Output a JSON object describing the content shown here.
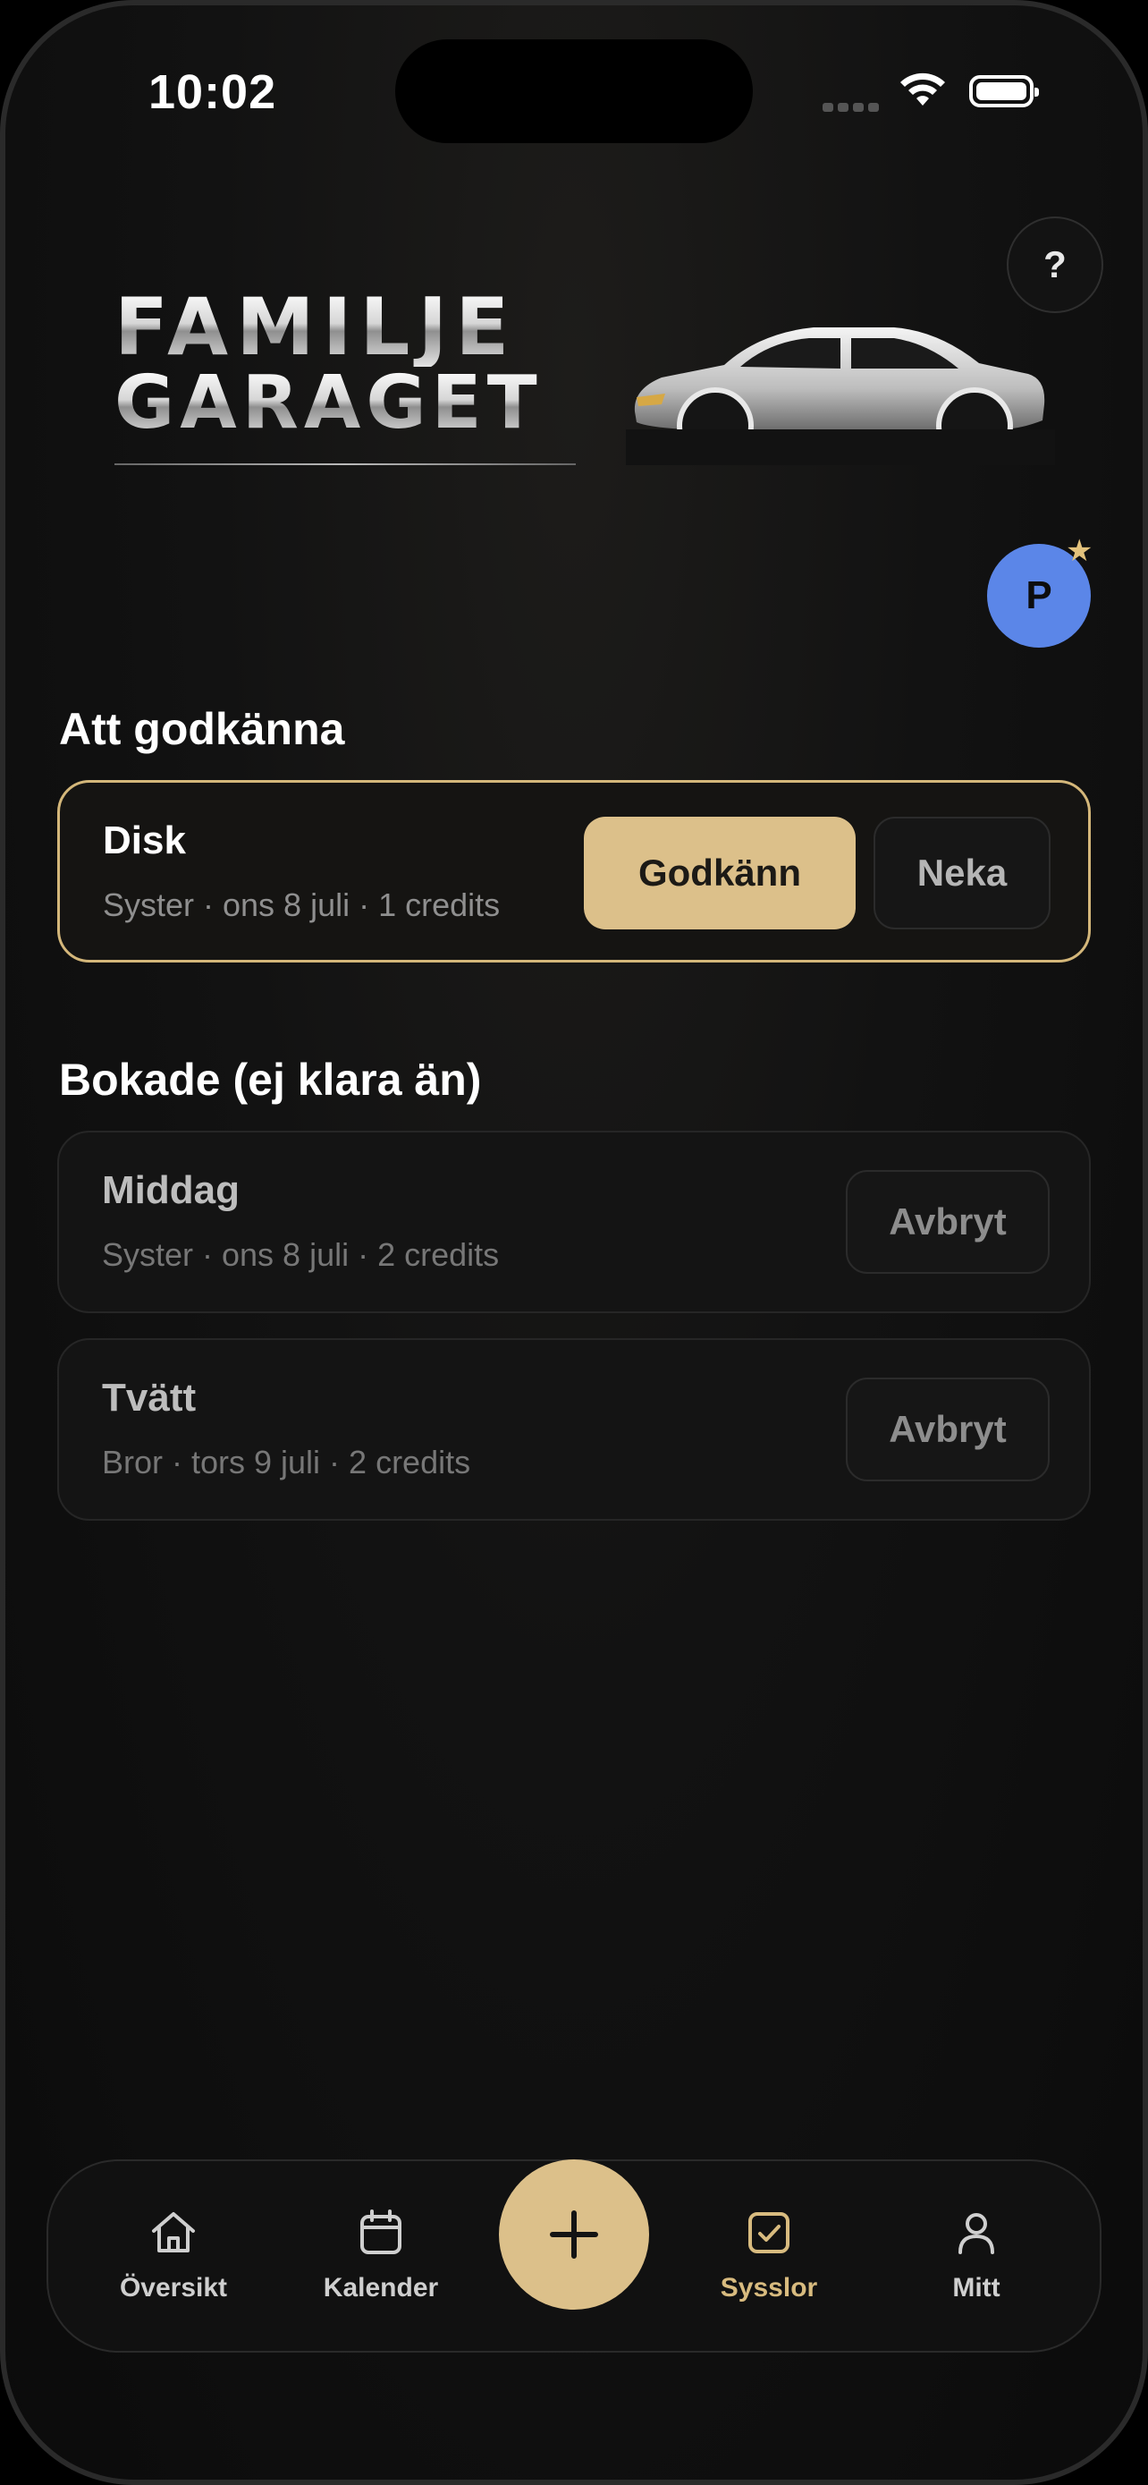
{
  "status_bar": {
    "time": "10:02"
  },
  "header": {
    "help_label": "?",
    "logo_line1": "FAMILJE",
    "logo_line2": "GARAGET",
    "avatar_initial": "P"
  },
  "pending": {
    "title": "Att godkänna",
    "items": [
      {
        "name": "Disk",
        "meta": "Syster · ons 8 juli · 1 credits",
        "approve_label": "Godkänn",
        "deny_label": "Neka"
      }
    ]
  },
  "booked": {
    "title": "Bokade (ej klara än)",
    "items": [
      {
        "name": "Middag",
        "meta": "Syster · ons 8 juli · 2 credits",
        "cancel_label": "Avbryt"
      },
      {
        "name": "Tvätt",
        "meta": "Bror · tors 9 juli · 2 credits",
        "cancel_label": "Avbryt"
      }
    ]
  },
  "tabbar": {
    "tabs": [
      {
        "label": "Översikt",
        "icon": "home-icon"
      },
      {
        "label": "Kalender",
        "icon": "calendar-icon"
      },
      {
        "label": "Sysslor",
        "icon": "checkbox-icon",
        "active": true
      },
      {
        "label": "Mitt",
        "icon": "person-icon"
      }
    ],
    "add_icon": "plus-icon"
  },
  "colors": {
    "accent": "#dcc08a",
    "avatar": "#5b86e8",
    "background": "#0f0f0f"
  }
}
